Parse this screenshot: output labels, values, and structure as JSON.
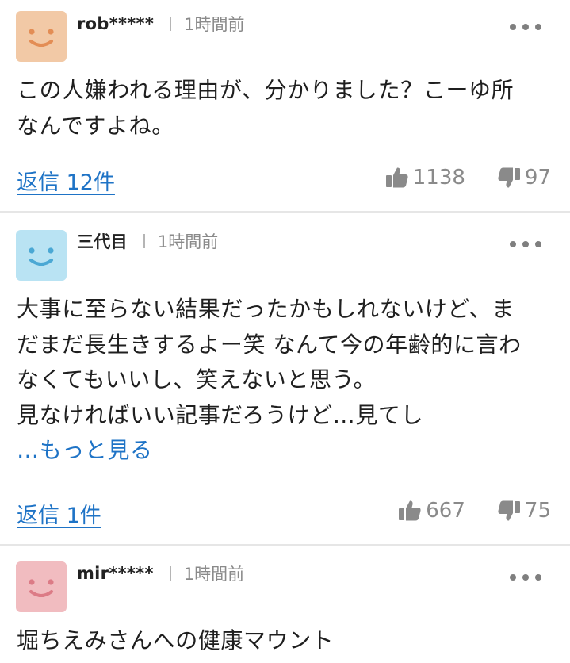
{
  "comments": [
    {
      "username": "rob*****",
      "time": "1時間前",
      "avatar_color": "#f2c9a6",
      "face_color": "#e38d55",
      "lines": [
        "この人嫌われる理由が、分かりました？こーゆ所",
        "なんですよね。"
      ],
      "reply_label": "返信 12件",
      "likes": "1138",
      "dislikes": "97"
    },
    {
      "username": "三代目",
      "time": "1時間前",
      "avatar_color": "#b9e3f3",
      "face_color": "#4ba8d4",
      "lines": [
        "大事に至らない結果だったかもしれないけど、ま",
        "だまだ長生きするよー笑 なんて今の年齢的に言わ",
        "なくてもいいし、笑えないと思う。",
        "見なければいい記事だろうけど…見てし"
      ],
      "more_label": "…もっと見る",
      "reply_label": "返信 1件",
      "likes": "667",
      "dislikes": "75"
    },
    {
      "username": "mir*****",
      "time": "1時間前",
      "avatar_color": "#f1bcc0",
      "face_color": "#dc7b86",
      "lines": [
        "堀ちえみさんへの健康マウント"
      ]
    }
  ],
  "icons": {
    "more": "more-dots-icon",
    "like": "thumbs-up-icon",
    "dislike": "thumbs-down-icon"
  },
  "colors": {
    "link": "#1e73c6",
    "muted": "#8a8a8a",
    "divider": "#e6e6e6"
  }
}
